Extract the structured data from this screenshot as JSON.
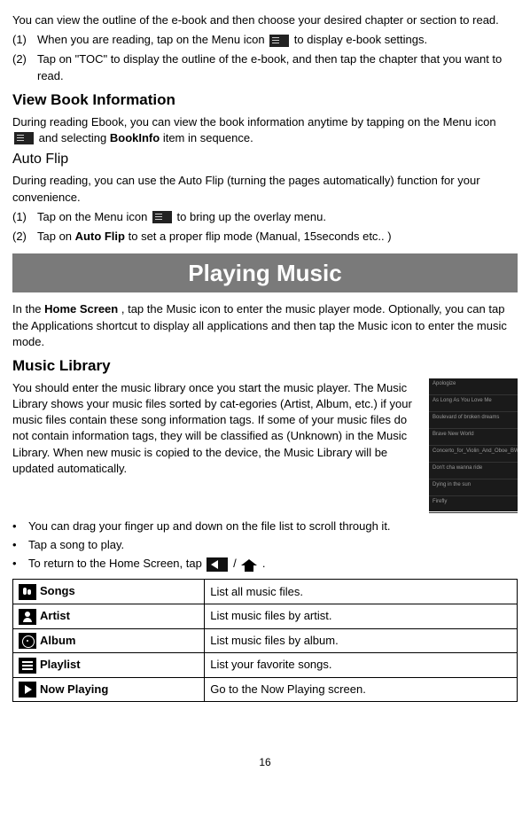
{
  "intro": {
    "outline_text": "You can view the outline of the e-book and then choose your desired chapter or section to read.",
    "step1_num": "(1)",
    "step1_a": "When you are reading, tap on the Menu icon ",
    "step1_b": " to display e-book settings.",
    "step2_num": "(2)",
    "step2": "Tap on \"TOC\" to display the outline of the e-book, and then tap the chapter that you want to read."
  },
  "view_book": {
    "heading": "View Book Information",
    "line1_a": "During reading Ebook, you can view the book information anytime by tapping on the Menu icon ",
    "line1_b": " and selecting ",
    "line1_bold": "BookInfo",
    "line1_c": " item in sequence."
  },
  "autoflip": {
    "heading": "Auto Flip",
    "line1": "During reading, you can use the Auto Flip (turning the pages automatically) function for your convenience.",
    "step1_num": "(1)",
    "step1_a": "Tap on the Menu icon ",
    "step1_b": " to bring up the overlay menu.",
    "step2_num": "(2)",
    "step2_a": "Tap on ",
    "step2_bold": "Auto Flip",
    "step2_b": " to set a proper flip mode (Manual, 15seconds etc.. )"
  },
  "playing": {
    "banner": "Playing Music",
    "intro_a": "In the ",
    "intro_bold": "Home Screen",
    "intro_b": ", tap the Music icon to enter the music player mode. Optionally, you can tap the Applications shortcut to display all applications and then tap the Music icon to enter the music mode."
  },
  "library": {
    "heading": "Music Library",
    "body": "You should enter the music library once you start the music player. The Music Library shows your music files sorted by cat-egories (Artist, Album, etc.) if your music files contain these song information tags. If some of your music files do not contain information tags, they will be classified as (Unknown) in the Music Library. When new music is copied to the device, the Music Library will be updated automatically.",
    "img_rows": [
      "Apologize",
      "As Long As You Love Me",
      "Boulevard of broken dreams",
      "Brave New World",
      "Concerto_for_Violin_And_Oboe_BW",
      "Don't cha wanna ride",
      "Dying in the sun",
      "Firefly"
    ]
  },
  "bullets": {
    "b1": "You can drag your finger up and down on the file list to scroll through it.",
    "b2": "Tap a song to play.",
    "b3_a": "To return to the Home Screen, tap ",
    "b3_mid": " / ",
    "b3_end": "."
  },
  "table": {
    "rows": [
      {
        "icon": "songs",
        "label": "Songs",
        "desc": "List all music files."
      },
      {
        "icon": "artist",
        "label": "Artist",
        "desc": "List music files by artist."
      },
      {
        "icon": "album",
        "label": "Album",
        "desc": "List music files by album."
      },
      {
        "icon": "playlist",
        "label": "Playlist",
        "desc": "List your favorite songs."
      },
      {
        "icon": "now",
        "label": "Now Playing",
        "desc": "Go to the Now Playing screen."
      }
    ]
  },
  "page_number": "16"
}
